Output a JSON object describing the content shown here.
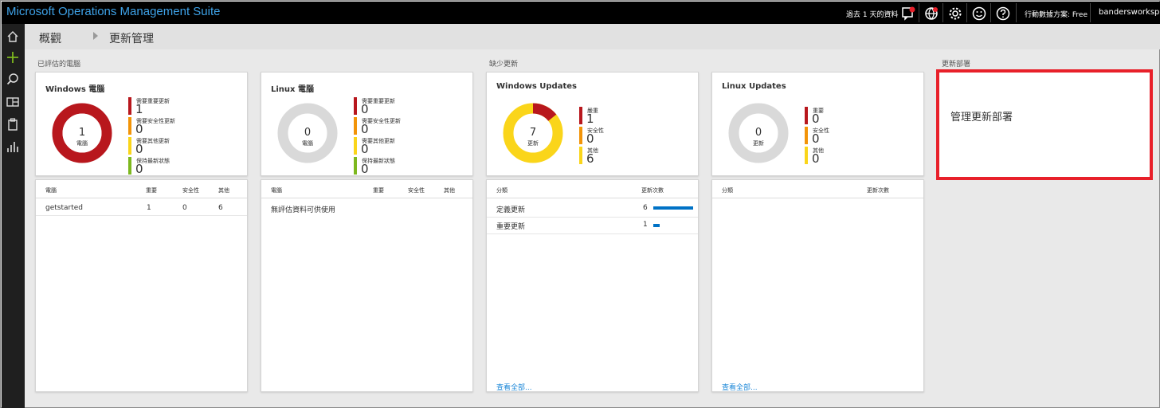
{
  "app": {
    "title": "Microsoft Operations Management Suite"
  },
  "topbar": {
    "time_range": "過去 1 天的資料",
    "plan_label": "行動數據方案: Free",
    "workspace": "bandersworkspace"
  },
  "icons": {
    "notification": "alert-icon",
    "globe": "globe-icon",
    "settings": "gear-icon",
    "feedback": "smiley-icon",
    "help": "help-icon"
  },
  "breadcrumb": {
    "home": "概觀",
    "current": "更新管理"
  },
  "sections": {
    "assessed": "已評估的電腦",
    "missing": "缺少更新",
    "deployments": "更新部署"
  },
  "colors": {
    "critical": "#b8171d",
    "security": "#f29408",
    "other": "#fad51a",
    "ok": "#7db81e",
    "empty": "#d9d9d9",
    "accent": "#0072c6",
    "highlight": "#e8202a"
  },
  "tiles": {
    "windows_pc": {
      "title": "Windows 電腦",
      "center_value": "1",
      "center_label": "電腦",
      "legend": [
        {
          "label": "需要重要更新",
          "value": "1"
        },
        {
          "label": "需要安全性更新",
          "value": "0"
        },
        {
          "label": "需要其他更新",
          "value": "0"
        },
        {
          "label": "保持最新狀態",
          "value": "0"
        }
      ]
    },
    "linux_pc": {
      "title": "Linux 電腦",
      "center_value": "0",
      "center_label": "電腦",
      "legend": [
        {
          "label": "需要重要更新",
          "value": "0"
        },
        {
          "label": "需要安全性更新",
          "value": "0"
        },
        {
          "label": "需要其他更新",
          "value": "0"
        },
        {
          "label": "保持最新狀態",
          "value": "0"
        }
      ]
    },
    "windows_updates": {
      "title": "Windows Updates",
      "center_value": "7",
      "center_label": "更新",
      "legend": [
        {
          "label": "嚴重",
          "value": "1"
        },
        {
          "label": "安全性",
          "value": "0"
        },
        {
          "label": "其他",
          "value": "6"
        }
      ]
    },
    "linux_updates": {
      "title": "Linux Updates",
      "center_value": "0",
      "center_label": "更新",
      "legend": [
        {
          "label": "重要",
          "value": "0"
        },
        {
          "label": "安全性",
          "value": "0"
        },
        {
          "label": "其他",
          "value": "0"
        }
      ]
    }
  },
  "lists": {
    "windows_pc": {
      "headers": [
        "電腦",
        "重要",
        "安全性",
        "其他"
      ],
      "rows": [
        [
          "getstarted",
          "1",
          "0",
          "6"
        ]
      ]
    },
    "linux_pc": {
      "headers": [
        "電腦",
        "重要",
        "安全性",
        "其他"
      ],
      "empty": "無評估資料可供使用"
    },
    "windows_updates": {
      "headers": [
        "分類",
        "更新次數"
      ],
      "rows": [
        {
          "name": "定義更新",
          "count": "6",
          "fraction": 1.0
        },
        {
          "name": "重要更新",
          "count": "1",
          "fraction": 0.167
        }
      ],
      "see_all": "查看全部..."
    },
    "linux_updates": {
      "headers": [
        "分類",
        "更新次數"
      ],
      "see_all": "查看全部..."
    }
  },
  "deployments": {
    "manage_label": "管理更新部署"
  }
}
